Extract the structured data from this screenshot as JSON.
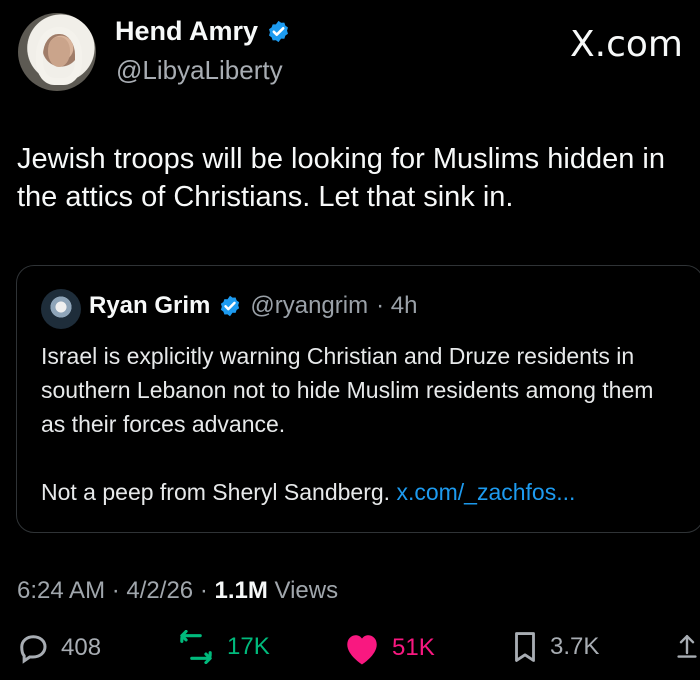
{
  "header": {
    "display_name": "Hend Amry",
    "handle": "@LibyaLiberty",
    "watermark": "X.com"
  },
  "tweet": {
    "text": "Jewish troops will be looking for Muslims hidden in the attics of Christians. Let that sink in."
  },
  "quote_tweet": {
    "display_name": "Ryan Grim",
    "handle": "@ryangrim",
    "time": "· 4h",
    "text_main": "Israel is explicitly warning Christian and Druze residents in southern Lebanon not to hide Muslim residents among them as their forces advance.",
    "text_extra": "Not a peep from Sheryl Sandberg.",
    "link": "x.com/_zachfos..."
  },
  "meta": {
    "time": "6:24 AM",
    "date": "4/2/26",
    "views_count": "1.1M",
    "views_label": "Views"
  },
  "actions": {
    "replies": "408",
    "reposts": "17K",
    "likes": "51K",
    "bookmarks": "3.7K"
  },
  "colors": {
    "background": "#000000",
    "accent_blue": "#1d9bf0",
    "repost_green": "#00ba7c",
    "like_pink": "#f91880",
    "text_secondary": "#a8adb3"
  },
  "icons": [
    "verified-badge-icon",
    "reply-icon",
    "repost-icon",
    "like-icon",
    "bookmark-icon",
    "share-icon"
  ]
}
